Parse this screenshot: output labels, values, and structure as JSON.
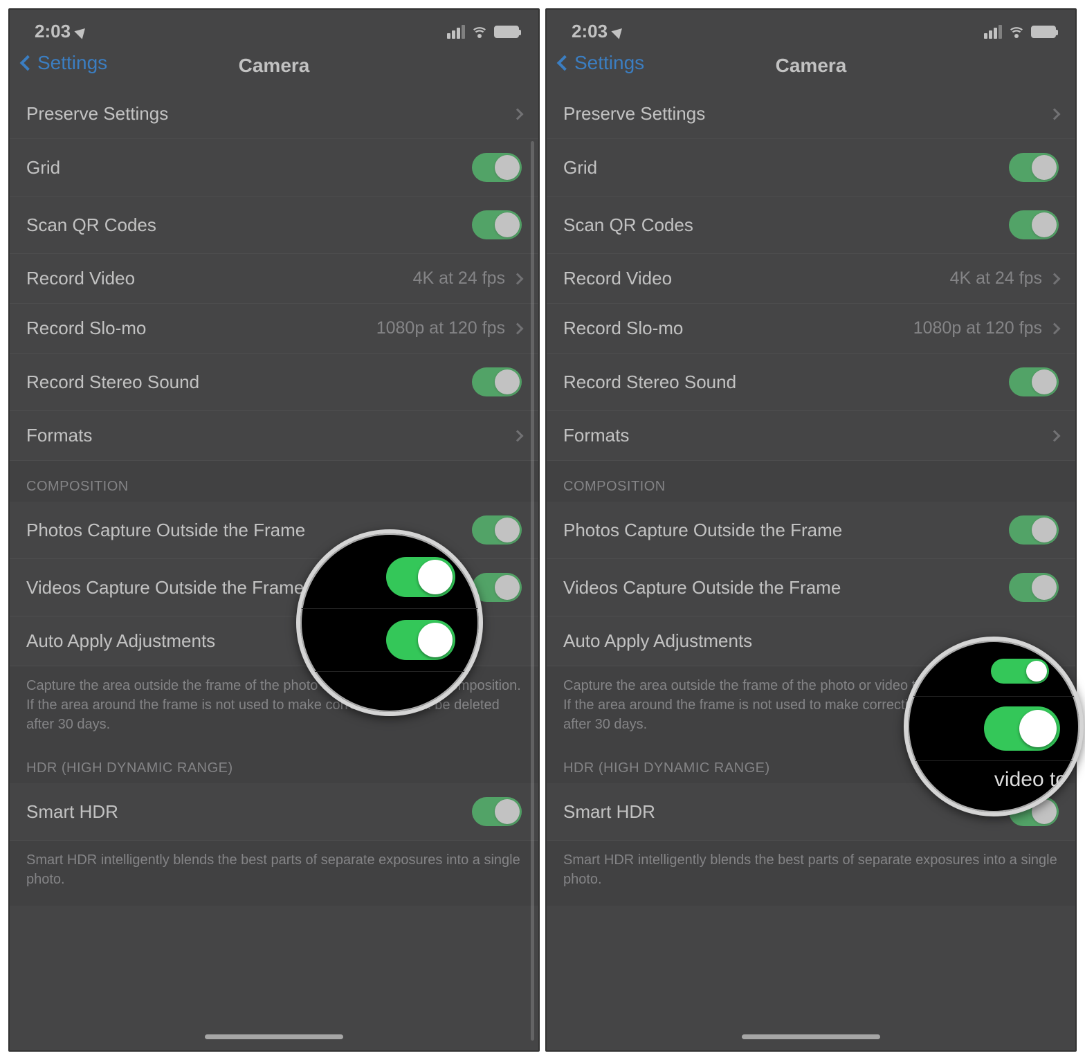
{
  "status": {
    "time": "2:03"
  },
  "nav": {
    "back": "Settings",
    "title": "Camera"
  },
  "rows": {
    "preserve": "Preserve Settings",
    "grid": "Grid",
    "qr": "Scan QR Codes",
    "recVideo": "Record Video",
    "recVideoVal": "4K at 24 fps",
    "recSlomo": "Record Slo-mo",
    "recSlomoVal": "1080p at 120 fps",
    "stereo": "Record Stereo Sound",
    "formats": "Formats"
  },
  "composition": {
    "header": "COMPOSITION",
    "photos": "Photos Capture Outside the Frame",
    "videos": "Videos Capture Outside the Frame",
    "auto": "Auto Apply Adjustments",
    "footer": "Capture the area outside the frame of the photo or video to improve composition. If the area around the frame is not used to make corrections, it will be deleted after 30 days."
  },
  "hdr": {
    "header": "HDR (HIGH DYNAMIC RANGE)",
    "smart": "Smart HDR",
    "footer": "Smart HDR intelligently blends the best parts of separate exposures into a single photo."
  },
  "mag2_text": "video to"
}
